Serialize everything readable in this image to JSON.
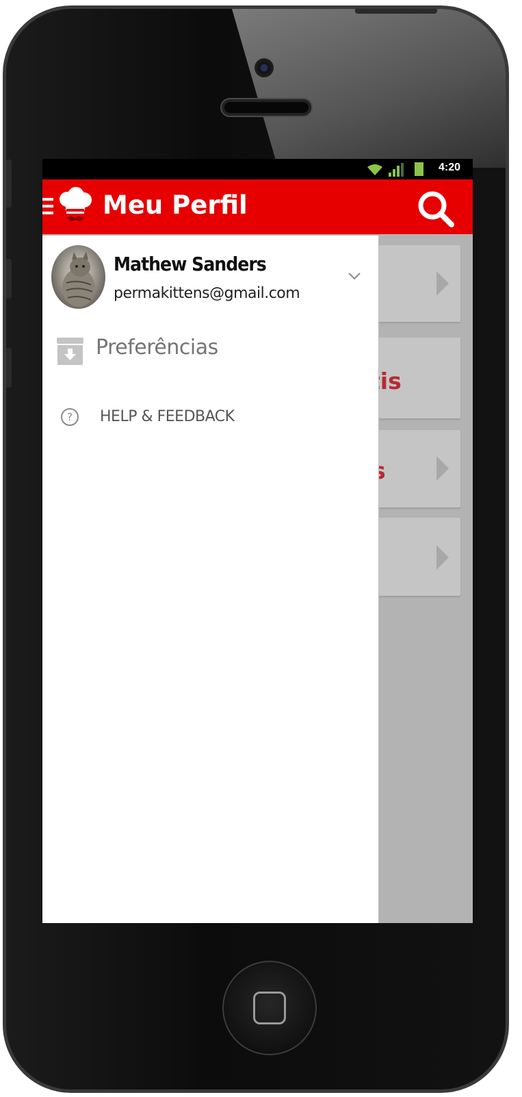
{
  "status_bar": {
    "time": "4:20"
  },
  "app_bar": {
    "title": "Meu Perfil"
  },
  "background_cards": [
    {
      "text": ""
    },
    {
      "text": "tis"
    },
    {
      "text": "s"
    },
    {
      "text": ""
    }
  ],
  "drawer": {
    "user": {
      "name": "Mathew Sanders",
      "email": "permakittens@gmail.com"
    },
    "items": [
      {
        "label": "Preferências",
        "icon": "archive-download-icon"
      },
      {
        "label": "HELP & FEEDBACK",
        "icon": "help-circle-icon"
      }
    ]
  },
  "colors": {
    "primary": "#e60000",
    "accent_text": "#b52b31",
    "scrim": "#b3b3b3"
  }
}
